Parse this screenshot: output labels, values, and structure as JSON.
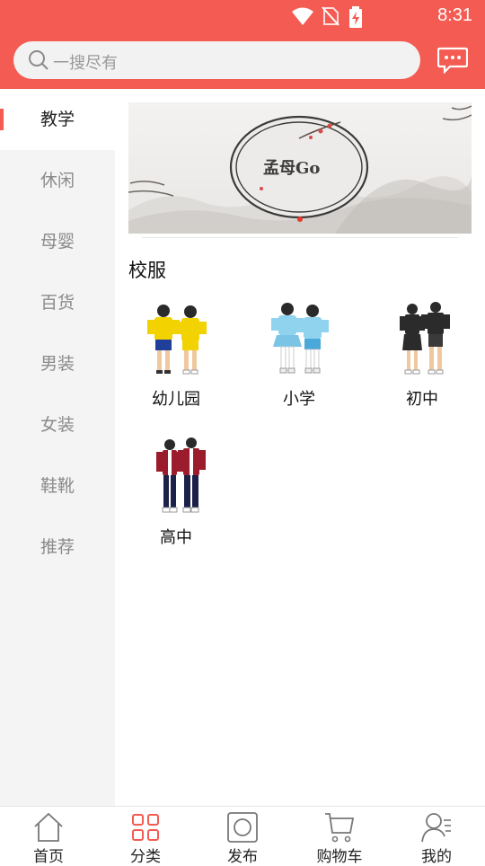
{
  "status_bar": {
    "time": "8:31",
    "icons": [
      "wifi-icon",
      "no-sim-icon",
      "battery-charging-icon"
    ]
  },
  "search": {
    "placeholder": "一搜尽有"
  },
  "header": {
    "message_icon": "chat-message-icon"
  },
  "sidebar": {
    "items": [
      {
        "label": "教学",
        "active": true
      },
      {
        "label": "休闲",
        "active": false
      },
      {
        "label": "母婴",
        "active": false
      },
      {
        "label": "百货",
        "active": false
      },
      {
        "label": "男装",
        "active": false
      },
      {
        "label": "女装",
        "active": false
      },
      {
        "label": "鞋靴",
        "active": false
      },
      {
        "label": "推荐",
        "active": false
      }
    ]
  },
  "banner": {
    "logo_text": "孟母Go"
  },
  "section": {
    "title": "校服",
    "items": [
      {
        "label": "幼儿园"
      },
      {
        "label": "小学"
      },
      {
        "label": "初中"
      },
      {
        "label": "高中"
      }
    ]
  },
  "bottom_nav": {
    "items": [
      {
        "label": "首页",
        "icon": "home-icon",
        "active": false
      },
      {
        "label": "分类",
        "icon": "category-grid-icon",
        "active": true
      },
      {
        "label": "发布",
        "icon": "publish-icon",
        "active": false
      },
      {
        "label": "购物车",
        "icon": "cart-icon",
        "active": false
      },
      {
        "label": "我的",
        "icon": "profile-icon",
        "active": false
      }
    ]
  },
  "colors": {
    "accent": "#f45b52",
    "sidebar_bg": "#f4f4f4",
    "text_muted": "#8a8a8a"
  }
}
